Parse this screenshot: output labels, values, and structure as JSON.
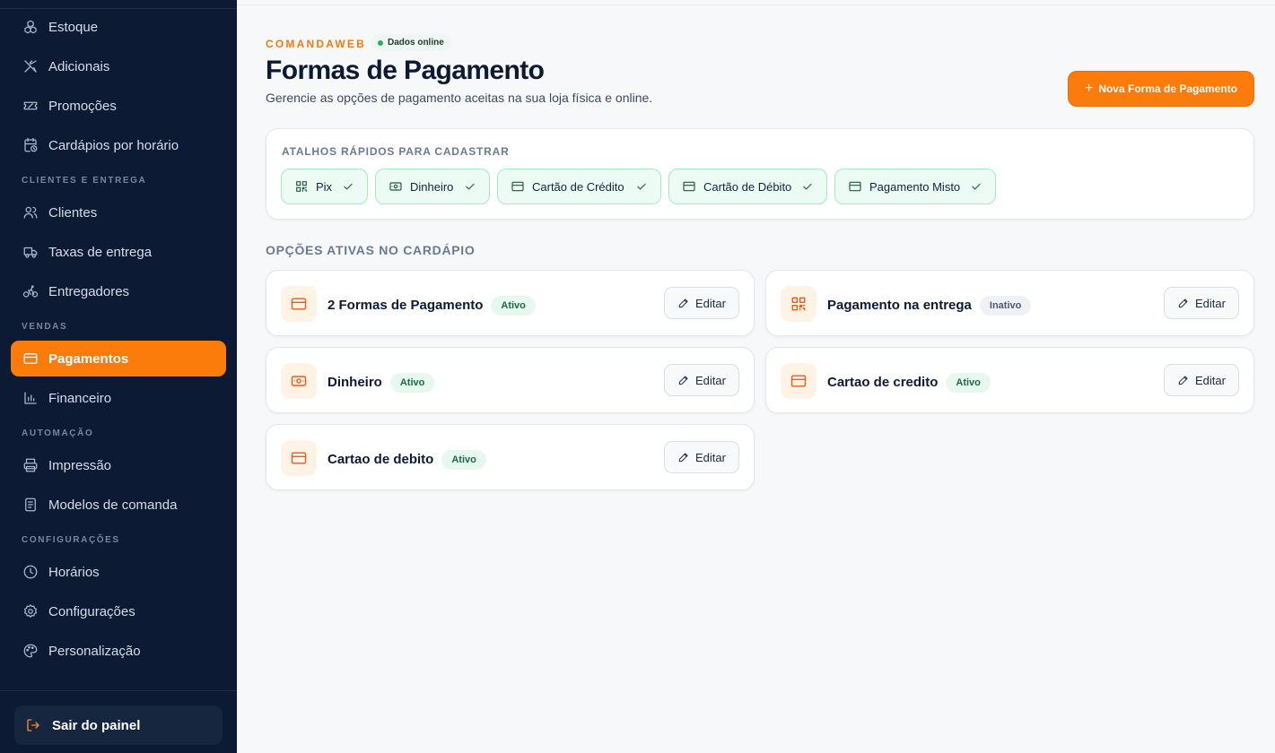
{
  "sidebar": {
    "items": [
      {
        "label": "Estoque",
        "icon": "boxes-icon"
      },
      {
        "label": "Adicionais",
        "icon": "utensils-icon"
      },
      {
        "label": "Promoções",
        "icon": "ticket-icon"
      },
      {
        "label": "Cardápios por horário",
        "icon": "calendar-clock-icon"
      },
      {
        "label": "Clientes",
        "icon": "users-icon"
      },
      {
        "label": "Taxas de entrega",
        "icon": "truck-icon"
      },
      {
        "label": "Entregadores",
        "icon": "bike-icon"
      },
      {
        "label": "Pagamentos",
        "icon": "credit-card-icon",
        "active": true
      },
      {
        "label": "Financeiro",
        "icon": "bar-chart-icon"
      },
      {
        "label": "Impressão",
        "icon": "printer-icon"
      },
      {
        "label": "Modelos de comanda",
        "icon": "document-icon"
      },
      {
        "label": "Horários",
        "icon": "clock-icon"
      },
      {
        "label": "Configurações",
        "icon": "gear-icon"
      },
      {
        "label": "Personalização",
        "icon": "palette-icon"
      }
    ],
    "sections": {
      "clientes": "CLIENTES E ENTREGA",
      "vendas": "VENDAS",
      "automacao": "AUTOMAÇÃO",
      "config": "CONFIGURAÇÕES"
    },
    "logout_label": "Sair do painel"
  },
  "header": {
    "brand": "COMANDAWEB",
    "status": "Dados online",
    "title": "Formas de Pagamento",
    "subtitle": "Gerencie as opções de pagamento aceitas na sua loja física e online.",
    "new_button": "Nova Forma de Pagamento"
  },
  "shortcuts": {
    "title": "ATALHOS RÁPIDOS PARA CADASTRAR",
    "chips": [
      {
        "label": "Pix",
        "icon": "qr-icon"
      },
      {
        "label": "Dinheiro",
        "icon": "cash-icon"
      },
      {
        "label": "Cartão de Crédito",
        "icon": "credit-card-icon"
      },
      {
        "label": "Cartão de Débito",
        "icon": "credit-card-icon"
      },
      {
        "label": "Pagamento Misto",
        "icon": "credit-card-icon"
      }
    ]
  },
  "active_options": {
    "title": "OPÇÕES ATIVAS NO CARDÁPIO",
    "edit_label": "Editar",
    "cards": [
      {
        "name": "2 Formas de Pagamento",
        "status": "Ativo",
        "icon": "credit-card-icon"
      },
      {
        "name": "Pagamento na entrega",
        "status": "Inativo",
        "icon": "qr-icon"
      },
      {
        "name": "Dinheiro",
        "status": "Ativo",
        "icon": "cash-icon"
      },
      {
        "name": "Cartao de credito",
        "status": "Ativo",
        "icon": "credit-card-icon"
      },
      {
        "name": "Cartao de debito",
        "status": "Ativo",
        "icon": "credit-card-icon"
      }
    ]
  },
  "colors": {
    "sidebar_bg": "#0c1a33",
    "accent": "#fb7b0b",
    "chip_bg": "#ecfbf3",
    "active_badge": "#e7f8ee"
  }
}
